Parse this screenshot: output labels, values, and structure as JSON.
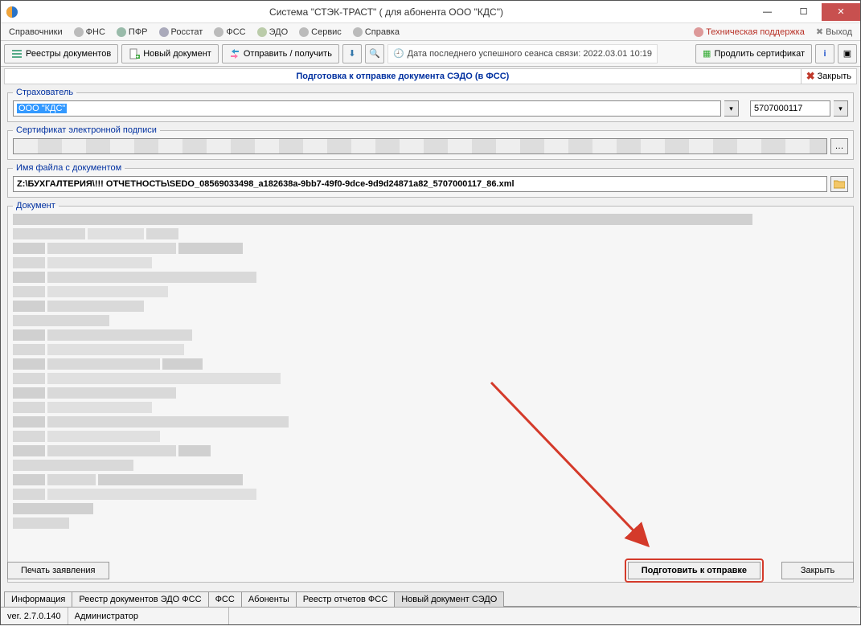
{
  "title": "Система \"СТЭК-ТРАСТ\" ( для абонента ООО \"КДС\")",
  "menu": {
    "items": [
      {
        "label": "Справочники"
      },
      {
        "label": "ФНС"
      },
      {
        "label": "ПФР"
      },
      {
        "label": "Росстат"
      },
      {
        "label": "ФСС"
      },
      {
        "label": "ЭДО"
      },
      {
        "label": "Сервис"
      },
      {
        "label": "Справка"
      }
    ],
    "tech_support": "Техническая поддержка",
    "exit": "Выход"
  },
  "toolbar": {
    "registries": "Реестры документов",
    "new_doc": "Новый документ",
    "send_receive": "Отправить / получить",
    "last_session": "Дата последнего успешного сеанса связи: 2022.03.01 10:19",
    "extend_cert": "Продлить сертификат"
  },
  "inner": {
    "title": "Подготовка к отправке документа СЭДО (в ФСС)",
    "close": "Закрыть"
  },
  "groups": {
    "insurer": "Страхователь",
    "insurer_value": "ООО \"КДС\"",
    "code": "5707000117",
    "cert": "Сертификат электронной подписи",
    "filename_label": "Имя файла с документом",
    "filename": "Z:\\БУХГАЛТЕРИЯ\\!!! ОТЧЕТНОСТЬ\\SEDO_08569033498_a182638a-9bb7-49f0-9dce-9d9d24871a82_5707000117_86.xml",
    "document": "Документ"
  },
  "buttons": {
    "print": "Печать заявления",
    "prepare": "Подготовить к отправке",
    "close": "Закрыть"
  },
  "tabs": [
    "Информация",
    "Реестр документов ЭДО ФСС",
    "ФСС",
    "Абоненты",
    "Реестр отчетов ФСС",
    "Новый документ СЭДО"
  ],
  "status": {
    "version": "ver. 2.7.0.140",
    "user": "Администратор"
  }
}
